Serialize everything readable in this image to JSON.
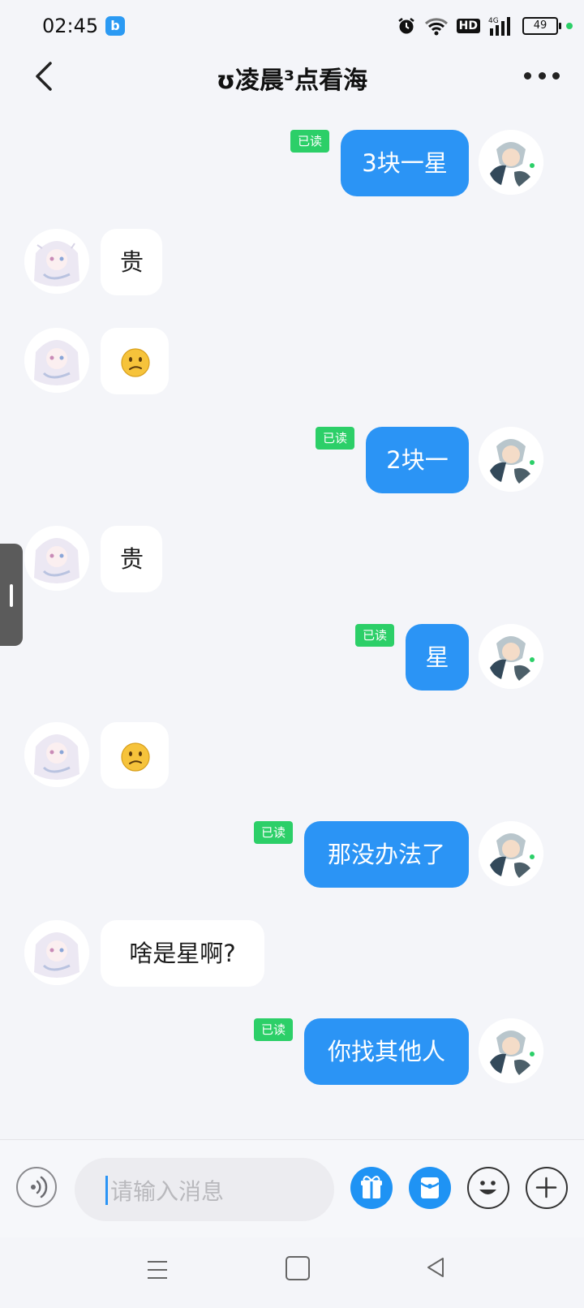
{
  "status_bar": {
    "time": "02:45",
    "app_badge": "b",
    "network_badge": "HD",
    "network_type": "4G",
    "battery": "49"
  },
  "header": {
    "title": "ʊ凌晨³点看海"
  },
  "messages": [
    {
      "side": "out",
      "text": "3块一星",
      "read": "已读"
    },
    {
      "side": "in",
      "text": "贵"
    },
    {
      "side": "in",
      "emoji": "confused-face"
    },
    {
      "side": "out",
      "text": "2块一",
      "read": "已读"
    },
    {
      "side": "in",
      "text": "贵"
    },
    {
      "side": "out",
      "text": "星",
      "read": "已读"
    },
    {
      "side": "in",
      "emoji": "confused-face"
    },
    {
      "side": "out",
      "text": "那没办法了",
      "read": "已读"
    },
    {
      "side": "in",
      "text": "啥是星啊?"
    },
    {
      "side": "out",
      "text": "你找其他人",
      "read": "已读"
    }
  ],
  "composer": {
    "placeholder": "请输入消息",
    "icons": [
      "voice-icon",
      "gift-icon",
      "red-packet-icon",
      "emoji-icon",
      "plus-icon"
    ]
  },
  "colors": {
    "outgoing_bubble": "#2b94f5",
    "read_badge": "#2ccf68",
    "background": "#f4f5f9"
  }
}
